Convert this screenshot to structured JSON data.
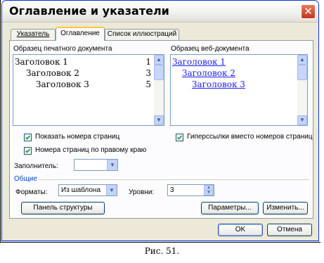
{
  "window": {
    "title": "Оглавление и указатели"
  },
  "tabs": [
    {
      "label": "Указатель",
      "underline": "У"
    },
    {
      "label": "Оглавление",
      "underline": "О"
    },
    {
      "label": "Список иллюстраций",
      "underline": ""
    }
  ],
  "print_preview": {
    "label": "Образец печатного документа",
    "rows": [
      {
        "text": "Заголовок 1",
        "page": "1"
      },
      {
        "text": "Заголовок 2",
        "page": "3"
      },
      {
        "text": "Заголовок 3",
        "page": "5"
      }
    ]
  },
  "web_preview": {
    "label": "Образец веб-документа",
    "rows": [
      "Заголовок 1",
      "Заголовок 2",
      "Заголовок 3"
    ]
  },
  "options": {
    "show_page_numbers": {
      "label": "Показать номера страниц",
      "checked": true
    },
    "right_align": {
      "label": "Номера страниц по правому краю",
      "checked": true
    },
    "hyperlinks": {
      "label": "Гиперссылки вместо номеров страниц",
      "checked": true
    },
    "filler_label": "Заполнитель:",
    "filler_value": ""
  },
  "general": {
    "label": "Общие",
    "formats_label": "Форматы:",
    "formats_value": "Из шаблона",
    "levels_label": "Уровни:",
    "levels_value": "3"
  },
  "buttons": {
    "outline_panel": "Панель структуры",
    "parameters": "Параметры...",
    "modify": "Изменить...",
    "ok": "OK",
    "cancel": "Отмена"
  },
  "caption": "Рис. 51."
}
